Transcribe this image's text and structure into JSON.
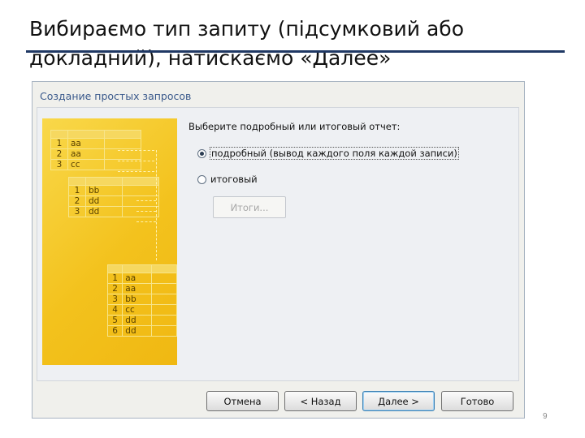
{
  "slide": {
    "title": "Вибираємо тип запиту (підсумковий або докладний), натискаємо «Далее»",
    "page_number": "9"
  },
  "dialog": {
    "title": "Создание простых запросов",
    "prompt": "Выберите подробный или итоговый отчет:",
    "options": [
      {
        "label": "подробный (вывод каждого поля каждой записи)",
        "selected": true
      },
      {
        "label": "итоговый",
        "selected": false
      }
    ],
    "summary_button": "Итоги...",
    "buttons": {
      "cancel": "Отмена",
      "back": "< Назад",
      "next": "Далее >",
      "finish": "Готово"
    }
  },
  "illustration": {
    "table1": [
      [
        "1",
        "aa"
      ],
      [
        "2",
        "aa"
      ],
      [
        "3",
        "cc"
      ]
    ],
    "table2": [
      [
        "1",
        "bb"
      ],
      [
        "2",
        "dd"
      ],
      [
        "3",
        "dd"
      ]
    ],
    "table3": [
      [
        "1",
        "aa"
      ],
      [
        "2",
        "aa"
      ],
      [
        "3",
        "bb"
      ],
      [
        "4",
        "cc"
      ],
      [
        "5",
        "dd"
      ],
      [
        "6",
        "dd"
      ]
    ]
  },
  "colors": {
    "title_rule": "#1f3864",
    "dialog_title": "#3b5a8c",
    "art_background": "#f3c21d"
  }
}
